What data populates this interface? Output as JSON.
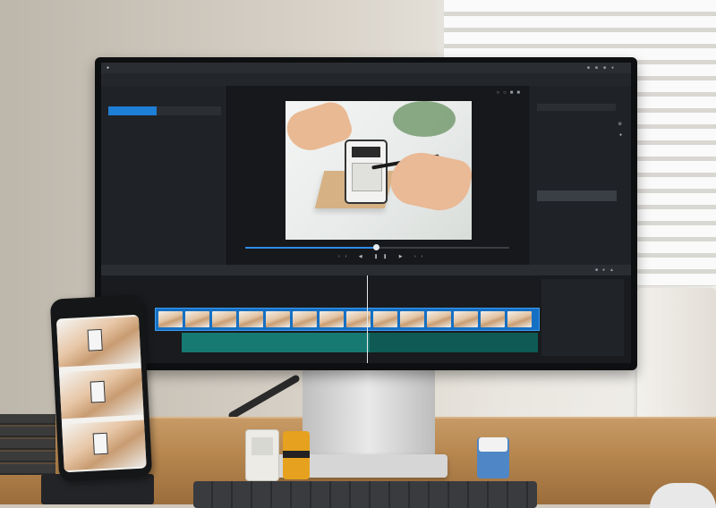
{
  "scene": {
    "description_colors": {
      "wall": "#d8d2c8",
      "desk": "#b7874f",
      "accent_blue": "#1e7fd6",
      "track_green": "#167a73"
    }
  },
  "app": {
    "menu": [
      "",
      "",
      "",
      "",
      "",
      "",
      "",
      ""
    ],
    "window_title": "",
    "media_panel": {
      "header": "",
      "sub": "",
      "selected": ""
    },
    "viewer": {
      "title": "",
      "time_left": "",
      "time_right": "",
      "ctrl_left": "",
      "ctrl_left2": "",
      "ctrl_time": ""
    },
    "inspector": {
      "title": "",
      "button": ""
    },
    "timeline": {
      "tabs": [
        "",
        "",
        ""
      ],
      "clip_label": "",
      "clip_count": 14
    }
  },
  "icons": [
    "apple-icon",
    "search-icon",
    "gear-icon",
    "play-icon",
    "pause-icon",
    "skip-back-icon",
    "skip-forward-icon",
    "scissors-icon",
    "magnet-icon"
  ]
}
